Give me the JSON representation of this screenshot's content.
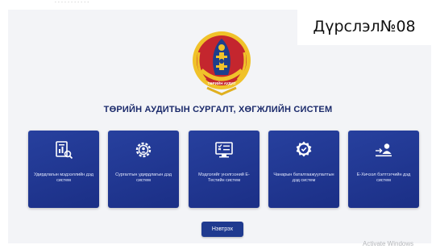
{
  "topbar": {
    "text": "‑ ‑ ‑ ‑ ‑ ‑ ‑ ‑ ‑ ‑ ‑"
  },
  "caption": "Дүрслэл№08",
  "emblem": {
    "icon": "state-audit-emblem",
    "text": "ТӨРИЙН АУДИТ"
  },
  "title": "ТӨРИЙН АУДИТЫН СУРГАЛТ, ХӨГЖЛИЙН СИСТЕМ",
  "tiles": [
    {
      "label": "Удирдлагын мэдээллийн дэд систем",
      "icon": "report-search-icon"
    },
    {
      "label": "Сургалтын удирдлагын дэд систем",
      "icon": "gear-person-icon"
    },
    {
      "label": "Мэдлэгийг үнэлгээний E-Тестийн систем",
      "icon": "test-checklist-icon"
    },
    {
      "label": "Чанарын баталгаажуулалтын дэд систем",
      "icon": "quality-badge-icon"
    },
    {
      "label": "E-Хичээл бэлтгэгчийн дэд систем",
      "icon": "lesson-user-icon"
    }
  ],
  "login_label": "Нэвтрэх",
  "watermark": "Activate Windows",
  "colors": {
    "tile": "#1f3590",
    "title": "#1b2a6b",
    "background": "#f3f4f7"
  }
}
